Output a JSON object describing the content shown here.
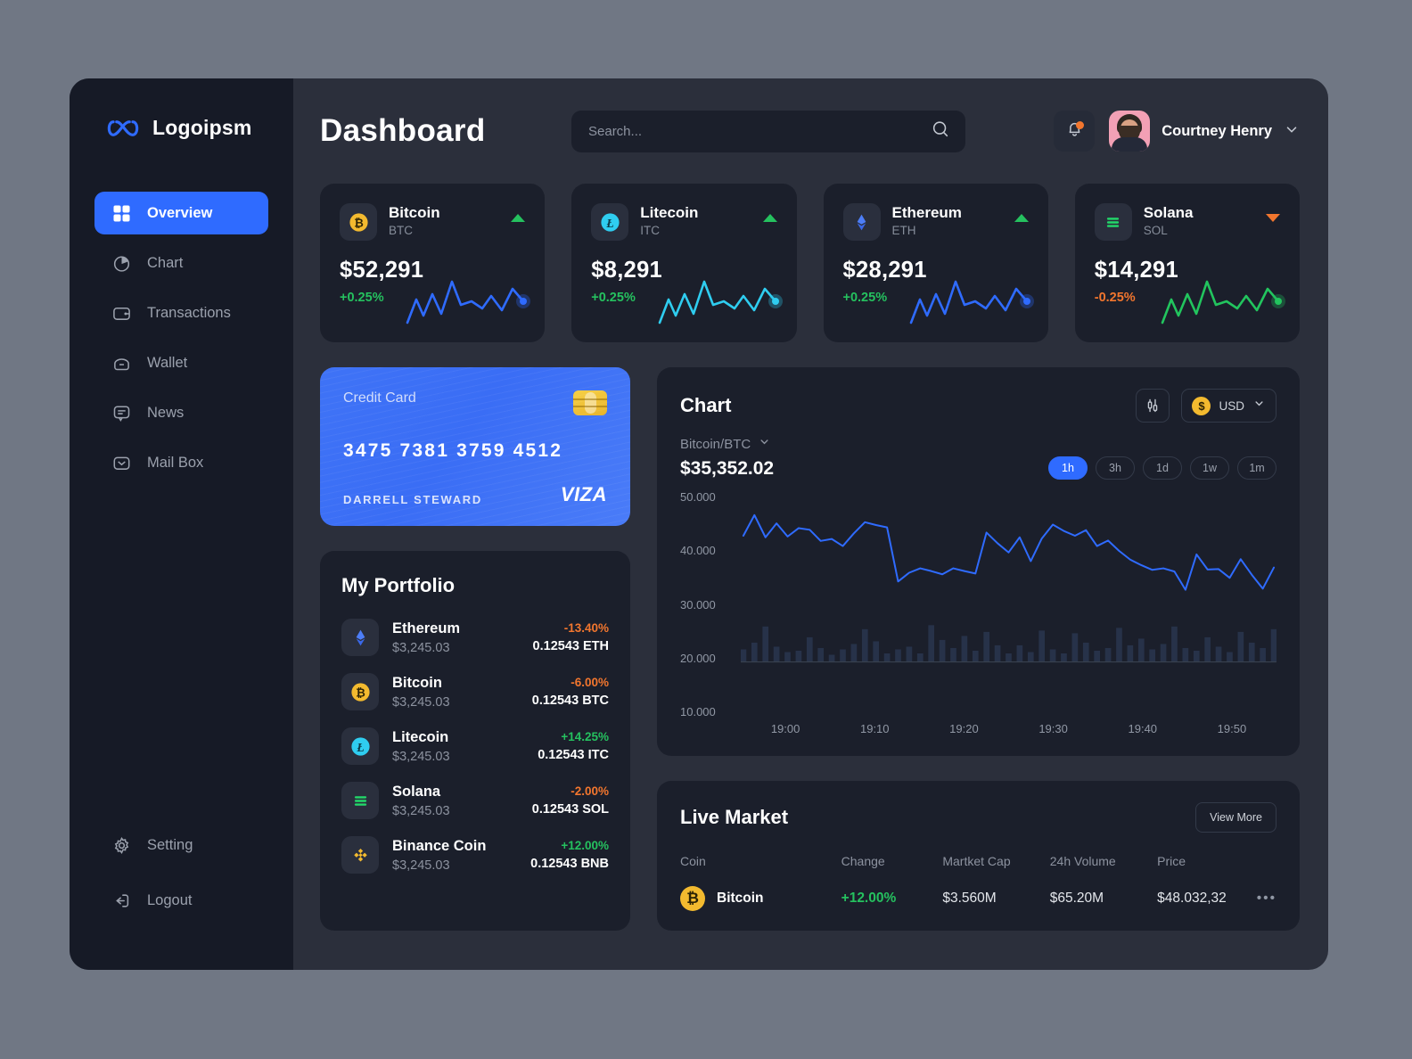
{
  "brand": {
    "name": "Logoipsm",
    "logo_icon": "infinity-logo-icon",
    "color": "#2f6bff"
  },
  "sidebar": {
    "items": [
      {
        "label": "Overview",
        "icon": "grid-icon",
        "active": true
      },
      {
        "label": "Chart",
        "icon": "pie-chart-icon",
        "active": false
      },
      {
        "label": "Transactions",
        "icon": "wallet-card-icon",
        "active": false
      },
      {
        "label": "Wallet",
        "icon": "wallet-icon",
        "active": false
      },
      {
        "label": "News",
        "icon": "message-icon",
        "active": false
      },
      {
        "label": "Mail Box",
        "icon": "mail-icon",
        "active": false
      }
    ],
    "bottom_items": [
      {
        "label": "Setting",
        "icon": "gear-icon"
      },
      {
        "label": "Logout",
        "icon": "logout-icon"
      }
    ]
  },
  "header": {
    "title": "Dashboard",
    "search": {
      "placeholder": "Search...",
      "value": "",
      "icon": "search-icon"
    },
    "notifications": {
      "icon": "bell-icon",
      "has_badge": true,
      "badge_color": "#f2762e"
    },
    "profile": {
      "name": "Courtney Henry",
      "avatar": "user-avatar",
      "chevron": "chevron-down-icon"
    }
  },
  "stats": [
    {
      "name": "Bitcoin",
      "symbol": "BTC",
      "price": "$52,291",
      "change": "+0.25%",
      "direction": "up",
      "icon": "bitcoin-icon",
      "accent": "#f3ba2f",
      "line_color": "#2f6bff"
    },
    {
      "name": "Litecoin",
      "symbol": "ITC",
      "price": "$8,291",
      "change": "+0.25%",
      "direction": "up",
      "icon": "litecoin-icon",
      "accent": "#2fcdf0",
      "line_color": "#2fcdf0"
    },
    {
      "name": "Ethereum",
      "symbol": "ETH",
      "price": "$28,291",
      "change": "+0.25%",
      "direction": "up",
      "icon": "ethereum-icon",
      "accent": "#3f6ff5",
      "line_color": "#2f6bff"
    },
    {
      "name": "Solana",
      "symbol": "SOL",
      "price": "$14,291",
      "change": "-0.25%",
      "direction": "down",
      "icon": "solana-icon",
      "accent": "#22d96a",
      "line_color": "#22c55e"
    }
  ],
  "credit_card": {
    "label": "Credit Card",
    "number": "3475 7381 3759 4512",
    "holder": "DARRELL STEWARD",
    "brand": "VIZA",
    "chip_icon": "emv-chip-icon"
  },
  "portfolio": {
    "title": "My Portfolio",
    "rows": [
      {
        "name": "Ethereum",
        "usd": "$3,245.03",
        "pct": "-13.40%",
        "direction": "down",
        "amount": "0.12543 ETH",
        "icon": "ethereum-icon"
      },
      {
        "name": "Bitcoin",
        "usd": "$3,245.03",
        "pct": "-6.00%",
        "direction": "down",
        "amount": "0.12543 BTC",
        "icon": "bitcoin-icon"
      },
      {
        "name": "Litecoin",
        "usd": "$3,245.03",
        "pct": "+14.25%",
        "direction": "up",
        "amount": "0.12543 ITC",
        "icon": "litecoin-icon"
      },
      {
        "name": "Solana",
        "usd": "$3,245.03",
        "pct": "-2.00%",
        "direction": "down",
        "amount": "0.12543 SOL",
        "icon": "solana-icon"
      },
      {
        "name": "Binance Coin",
        "usd": "$3,245.03",
        "pct": "+12.00%",
        "direction": "up",
        "amount": "0.12543 BNB",
        "icon": "binance-icon"
      }
    ]
  },
  "chart_panel": {
    "title": "Chart",
    "candle_icon": "candlestick-icon",
    "currency": {
      "label": "USD",
      "coin_icon": "dollar-coin-icon",
      "chevron": "chevron-down-icon"
    },
    "pair": "Bitcoin/BTC",
    "pair_chevron": "chevron-down-icon",
    "price": "$35,352.02",
    "ranges": [
      {
        "label": "1h",
        "active": true
      },
      {
        "label": "3h",
        "active": false
      },
      {
        "label": "1d",
        "active": false
      },
      {
        "label": "1w",
        "active": false
      },
      {
        "label": "1m",
        "active": false
      }
    ]
  },
  "chart_data": {
    "type": "line",
    "title": "Chart",
    "subtitle": "Bitcoin/BTC",
    "xlabel": "",
    "ylabel": "",
    "ylim": [
      10000,
      50000
    ],
    "xlim": [
      "19:00",
      "19:55"
    ],
    "grid": false,
    "legend": "none",
    "line_color": "#2f6bff",
    "volume_color": "#273249",
    "ytick_labels": [
      "50.000",
      "40.000",
      "30.000",
      "20.000",
      "10.000"
    ],
    "ytick_values": [
      50000,
      40000,
      30000,
      20000,
      10000
    ],
    "xtick_labels": [
      "19:00",
      "19:10",
      "19:20",
      "19:30",
      "19:40",
      "19:50"
    ],
    "series": [
      {
        "name": "Bitcoin/BTC price",
        "values": [
          41200,
          46400,
          40800,
          44300,
          41000,
          43100,
          42700,
          39900,
          40400,
          38600,
          41800,
          44600,
          43900,
          43300,
          29700,
          31900,
          33000,
          32300,
          31500,
          33000,
          32300,
          31700,
          42000,
          39300,
          37000,
          40800,
          34800,
          40500,
          44000,
          42400,
          41200,
          42600,
          38600,
          40000,
          37400,
          35200,
          33800,
          32600,
          33000,
          32200,
          27600,
          36500,
          32700,
          32800,
          30600,
          35300,
          31400,
          27900,
          33200
        ]
      }
    ],
    "volume": {
      "name": "Volume",
      "values": [
        9,
        14,
        26,
        11,
        7,
        8,
        18,
        10,
        5,
        9,
        13,
        24,
        15,
        6,
        9,
        11,
        6,
        27,
        16,
        10,
        19,
        8,
        22,
        12,
        6,
        12,
        7,
        23,
        9,
        6,
        21,
        14,
        8,
        10,
        25,
        12,
        17,
        9,
        13,
        26,
        10,
        8,
        18,
        11,
        7,
        22,
        14,
        10,
        24
      ]
    }
  },
  "live_market": {
    "title": "Live Market",
    "view_more": "View More",
    "columns": [
      "Coin",
      "Change",
      "Martket Cap",
      "24h Volume",
      "Price"
    ],
    "rows": [
      {
        "coin": "Bitcoin",
        "icon": "bitcoin-icon",
        "change": "+12.00%",
        "direction": "up",
        "market_cap": "$3.560M",
        "volume": "$65.20M",
        "price": "$48.032,32",
        "menu_icon": "more-horizontal-icon"
      }
    ]
  }
}
